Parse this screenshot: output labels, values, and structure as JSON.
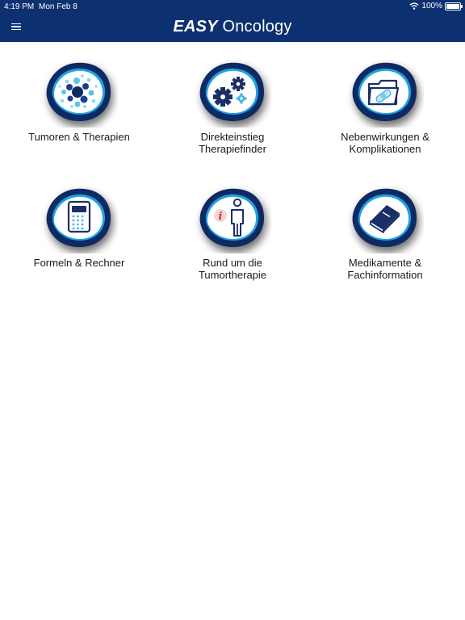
{
  "status": {
    "time": "4:19 PM",
    "date": "Mon Feb 8",
    "battery": "100%"
  },
  "header": {
    "title_bold": "EASY",
    "title_rest": "Oncology"
  },
  "colors": {
    "header_bg": "#0d3170",
    "blob_navy": "#0d2a62",
    "blob_light": "#1ba3e3",
    "icon_dark": "#1a2f66",
    "icon_red": "#d33333"
  },
  "tiles": [
    {
      "icon": "cells-icon",
      "label_lines": [
        "Tumoren & Therapien"
      ]
    },
    {
      "icon": "gears-icon",
      "label_lines": [
        "Direkteinstieg",
        "Therapiefinder"
      ]
    },
    {
      "icon": "folder-bandage-icon",
      "label_lines": [
        "Nebenwirkungen &",
        "Komplikationen"
      ]
    },
    {
      "icon": "calculator-icon",
      "label_lines": [
        "Formeln & Rechner"
      ]
    },
    {
      "icon": "person-info-icon",
      "label_lines": [
        "Rund um die",
        "Tumortherapie"
      ]
    },
    {
      "icon": "book-icon",
      "label_lines": [
        "Medikamente &",
        "Fachinformation"
      ]
    }
  ]
}
